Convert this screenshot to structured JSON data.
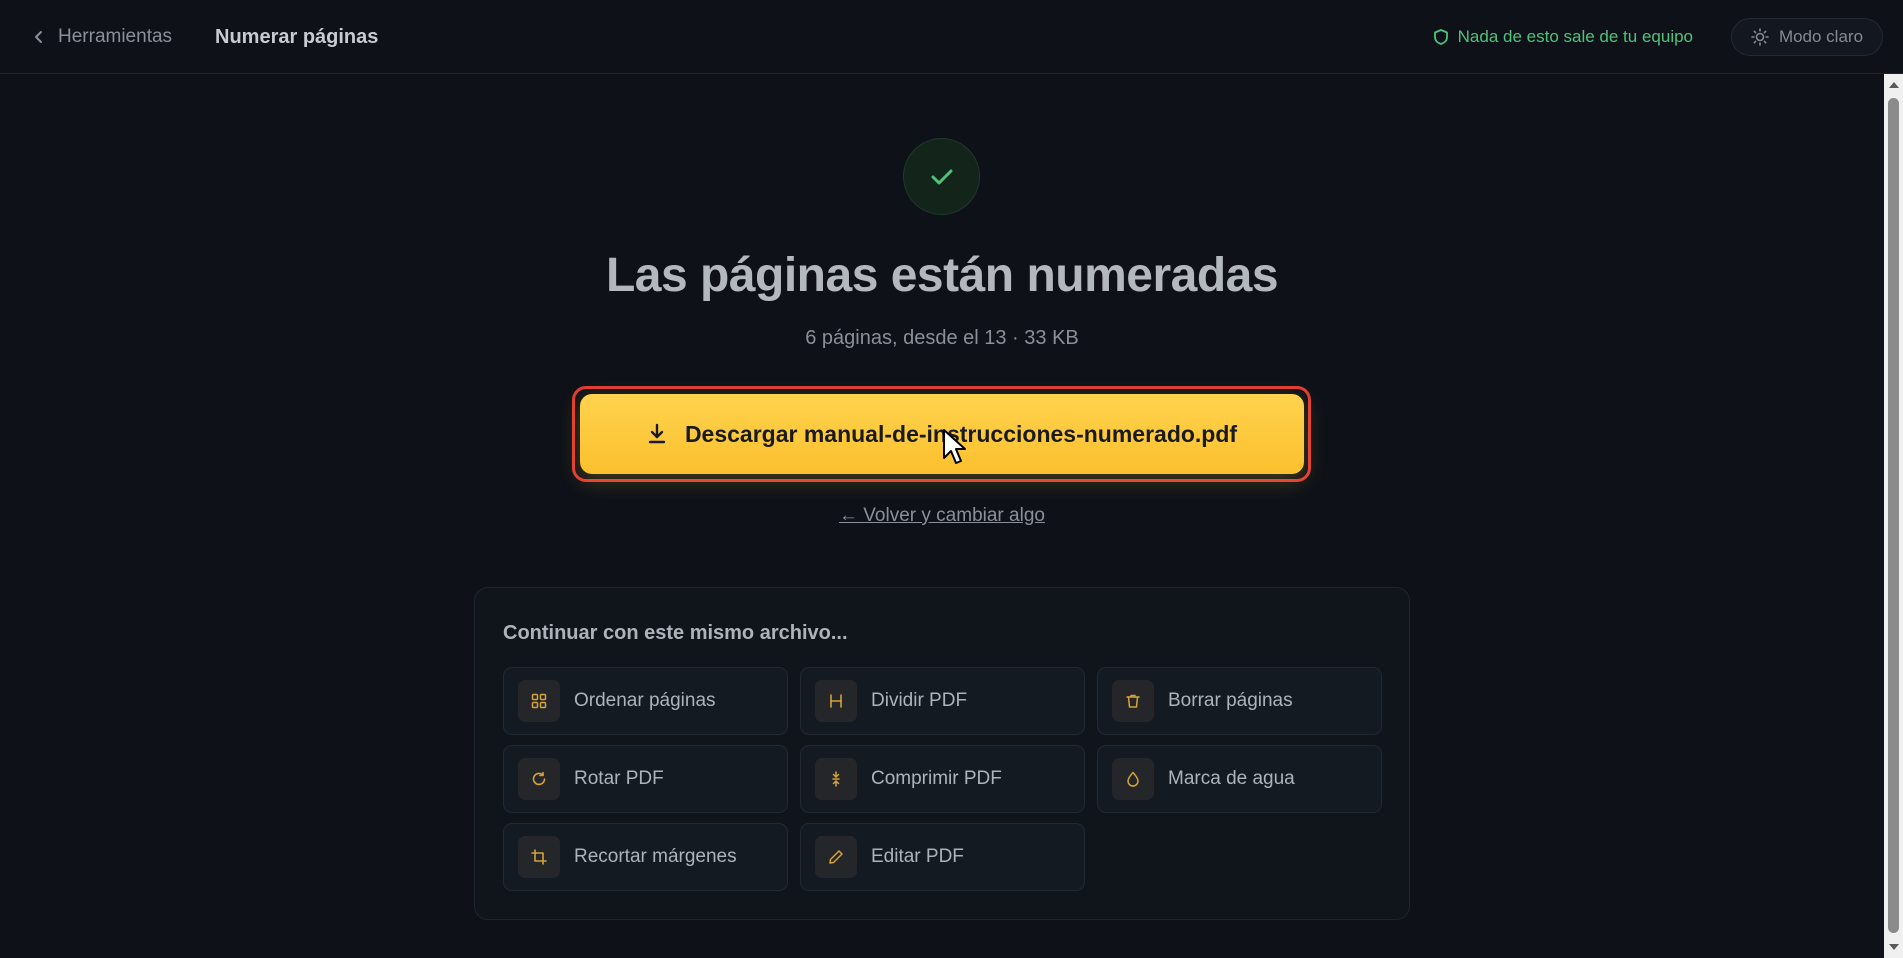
{
  "header": {
    "back_label": "Herramientas",
    "title": "Numerar páginas",
    "privacy_text": "Nada de esto sale de tu equipo",
    "theme_label": "Modo claro"
  },
  "result": {
    "headline": "Las páginas están numeradas",
    "summary": "6 páginas, desde el 13 · 33 KB",
    "download_label": "Descargar manual-de-instrucciones-numerado.pdf",
    "back_link": "← Volver y cambiar algo"
  },
  "continue": {
    "title": "Continuar con este mismo archivo...",
    "tools": [
      {
        "label": "Ordenar páginas",
        "icon": "grid-icon"
      },
      {
        "label": "Dividir PDF",
        "icon": "split-icon"
      },
      {
        "label": "Borrar páginas",
        "icon": "trash-icon"
      },
      {
        "label": "Rotar PDF",
        "icon": "rotate-icon"
      },
      {
        "label": "Comprimir PDF",
        "icon": "compress-icon"
      },
      {
        "label": "Marca de agua",
        "icon": "droplet-icon"
      },
      {
        "label": "Recortar márgenes",
        "icon": "crop-icon"
      },
      {
        "label": "Editar PDF",
        "icon": "pencil-icon"
      }
    ]
  },
  "colors": {
    "accent": "#fbc02d",
    "success": "#4ec27a",
    "highlight_outline": "#e23b34",
    "background": "#0e1218"
  }
}
